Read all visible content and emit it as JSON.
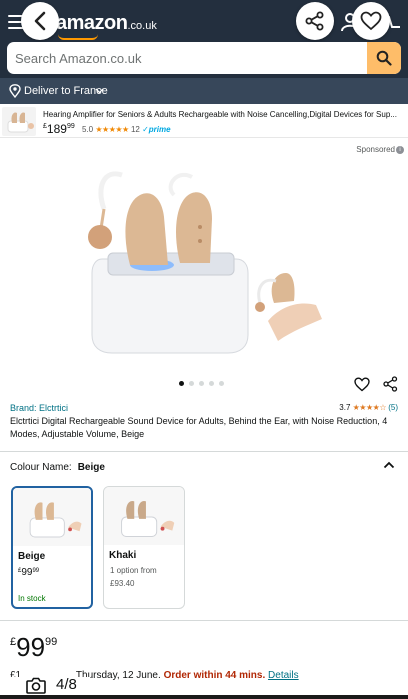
{
  "header": {
    "logo_text": "amazon",
    "logo_tld": ".co.uk",
    "back_icon": "chevron-left-icon",
    "share_icon": "share-icon",
    "wishlist_icon": "heart-icon",
    "brand_color": "#232f3e",
    "accent_color": "#febd69"
  },
  "search": {
    "placeholder": "Search Amazon.co.uk"
  },
  "delivery": {
    "label": "Deliver to France"
  },
  "ad": {
    "title": "Hearing Amplifier for Seniors & Adults Rechargeable with Noise Cancelling,Digital Devices for Sup...",
    "price_currency": "£",
    "price_whole": "189",
    "price_fraction": "99",
    "rating_value": "5.0",
    "rating_stars": "★★★★★",
    "rating_count": "12",
    "prime_label": "✓prime",
    "sponsored_label": "Sponsored"
  },
  "gallery": {
    "dots_total": 5,
    "dots_active": 1,
    "counter": "4/8"
  },
  "product": {
    "brand": "Brand: Elctrtici",
    "rating_value": "3.7",
    "rating_stars": "★★★★☆",
    "rating_count": "(5)",
    "title": "Elctrtici Digital Rechargeable Sound Device for Adults, Behind the Ear, with Noise Reduction, 4 Modes, Adjustable Volume, Beige"
  },
  "colour": {
    "label": "Colour Name:",
    "selected": "Beige",
    "options": [
      {
        "name": "Beige",
        "price_currency": "£",
        "price_whole": "99",
        "price_fraction": "99",
        "status": "In stock"
      },
      {
        "name": "Khaki",
        "options_text": "1 option from",
        "from_price": "£93.40"
      }
    ]
  },
  "price": {
    "currency": "£",
    "whole": "99",
    "fraction": "99"
  },
  "delivery_line": {
    "prefix": "£1",
    "date": "Thursday, 12 June.",
    "order_within": "Order within 44 mins.",
    "details_link": "Details"
  }
}
